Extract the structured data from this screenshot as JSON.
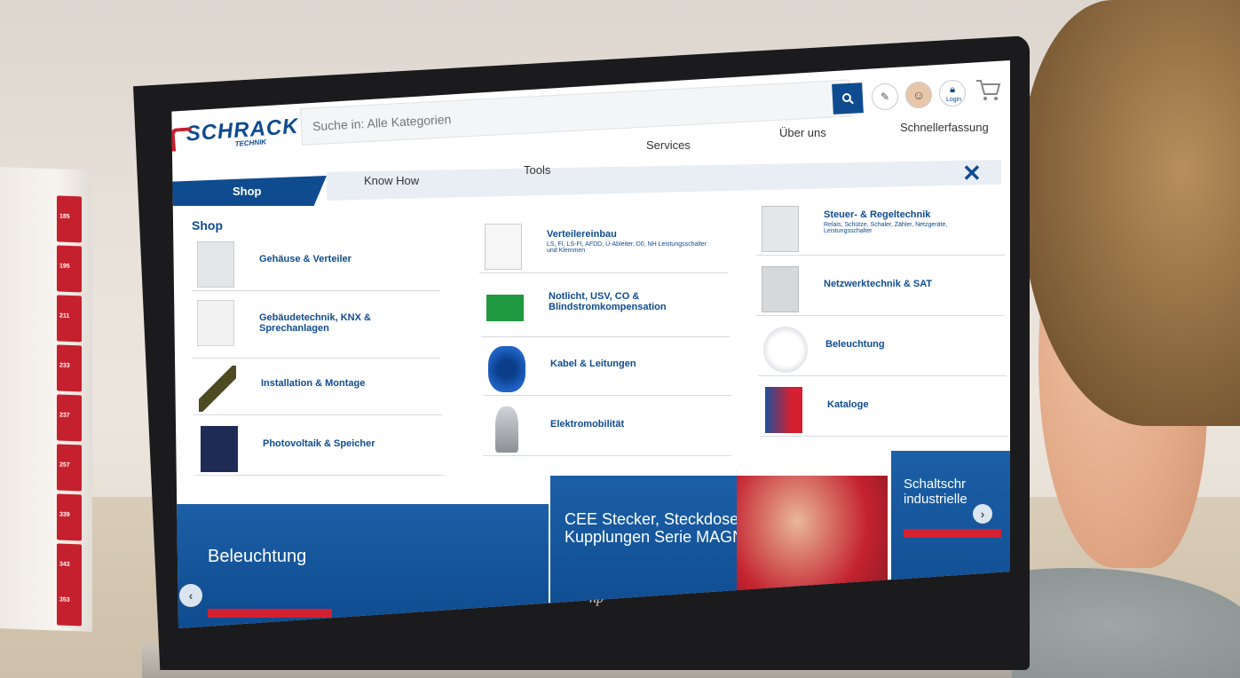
{
  "header": {
    "logo_text": "SCHRACK",
    "logo_sub": "TECHNIK",
    "search_placeholder": "Suche in: Alle Kategorien",
    "login_label": "Login",
    "top_nav": [
      "Services",
      "Über uns",
      "Schnellerfassung"
    ]
  },
  "tabs": {
    "shop": "Shop",
    "know_how": "Know How",
    "tools": "Tools"
  },
  "menu": {
    "title": "Shop",
    "col1": [
      {
        "label": "Gehäuse & Verteiler"
      },
      {
        "label": "Gebäudetechnik, KNX & Sprechanlagen"
      },
      {
        "label": "Installation & Montage"
      },
      {
        "label": "Photovoltaik & Speicher"
      }
    ],
    "col2": [
      {
        "label": "Verteilereinbau",
        "desc": "LS, FI, LS-FI, AFDD, Ü-Ableiter, D0, NH Leistungsschalter und Klemmen"
      },
      {
        "label": "Notlicht, USV, CO & Blindstromkompensation"
      },
      {
        "label": "Kabel & Leitungen"
      },
      {
        "label": "Elektromobilität"
      }
    ],
    "col3": [
      {
        "label": "Steuer- & Regeltechnik",
        "desc": "Relais, Schütze, Schaler, Zähler, Netzgeräte, Leistungsschalter"
      },
      {
        "label": "Netzwerktechnik & SAT"
      },
      {
        "label": "Beleuchtung"
      },
      {
        "label": "Kataloge"
      }
    ]
  },
  "banners": {
    "b1": "Beleuchtung",
    "b2": "CEE Stecker, Steckdosen und Kupplungen Serie MAGNUS",
    "b3": "Schaltschr industrielle"
  },
  "binder_tabs": [
    "185",
    "195",
    "211",
    "233",
    "237",
    "257",
    "339",
    "343",
    "353"
  ],
  "colors": {
    "brand_blue": "#0f4b8f",
    "brand_red": "#c5202d"
  }
}
